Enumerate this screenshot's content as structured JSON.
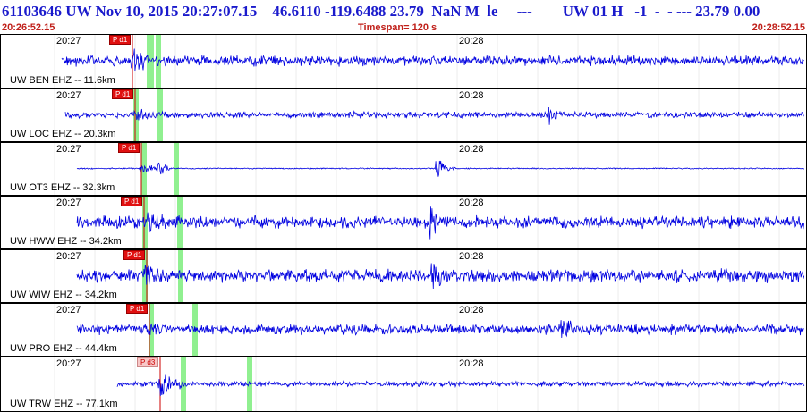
{
  "header": {
    "title": "61103646 UW Nov 10, 2015 20:27:07.15    46.6110 -119.6488 23.79  NaN M  le     ---        UW 01 H   -1  -  - --- 23.79 0.00"
  },
  "timebar": {
    "start": "20:26:52.15",
    "span": "Timespan= 120 s",
    "end": "20:28:52.15"
  },
  "colors": {
    "title": "#1a1acc",
    "timebar": "#c0201a",
    "trace": "#0000e0",
    "pick_line": "#cc0000",
    "phase_marker": "#90f090"
  },
  "panels": [
    {
      "station": "UW BEN EHZ -- 11.6km",
      "t1": "20:27",
      "t2": "20:28",
      "pick": "P d1",
      "pick_style": "solid"
    },
    {
      "station": "UW LOC EHZ -- 20.3km",
      "t1": "20:27",
      "t2": "20:28",
      "pick": "P d1",
      "pick_style": "solid"
    },
    {
      "station": "UW OT3 EHZ -- 32.3km",
      "t1": "20:27",
      "t2": "20:28",
      "pick": "P d1",
      "pick_style": "solid"
    },
    {
      "station": "UW HWW EHZ -- 34.2km",
      "t1": "20:27",
      "t2": "20:28",
      "pick": "P d1",
      "pick_style": "solid"
    },
    {
      "station": "UW WIW EHZ -- 34.2km",
      "t1": "20:27",
      "t2": "20:28",
      "pick": "P d1",
      "pick_style": "solid"
    },
    {
      "station": "UW PRO EHZ -- 44.4km",
      "t1": "20:27",
      "t2": "20:28",
      "pick": "P d1",
      "pick_style": "solid"
    },
    {
      "station": "UW TRW EHZ -- 77.1km",
      "t1": "20:27",
      "t2": "20:28",
      "pick": "P d3",
      "pick_style": "light"
    }
  ]
}
